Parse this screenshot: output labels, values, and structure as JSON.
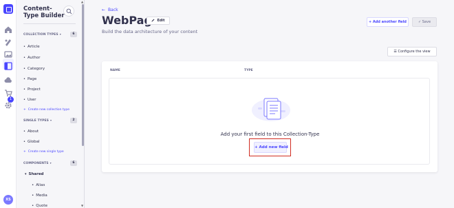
{
  "rail": {
    "badge_count": "1",
    "avatar_initials": "XS"
  },
  "panel": {
    "title": "Content-Type Builder",
    "collection_types": {
      "label": "COLLECTION TYPES",
      "count": "6",
      "items": [
        "Article",
        "Author",
        "Category",
        "Page",
        "Project",
        "User"
      ],
      "create": "Create new collection type"
    },
    "single_types": {
      "label": "SINGLE TYPES",
      "count": "2",
      "items": [
        "About",
        "Global"
      ],
      "create": "Create new single type"
    },
    "components": {
      "label": "COMPONENTS",
      "count": "6",
      "group": "Shared",
      "items": [
        "Alias",
        "Media",
        "Quote"
      ]
    }
  },
  "header": {
    "back": "Back",
    "title": "WebPage",
    "edit": "Edit",
    "subtitle": "Build the data architecture of your content",
    "add_another": "+ Add another field",
    "save": "✓ Save"
  },
  "configure": "☰ Configure the view",
  "table": {
    "col_name": "NAME",
    "col_type": "TYPE",
    "empty_text": "Add your first field to this Collection-Type",
    "add_new": "+ Add new field"
  },
  "colors": {
    "accent": "#4945ff",
    "highlight": "#d02b20"
  }
}
